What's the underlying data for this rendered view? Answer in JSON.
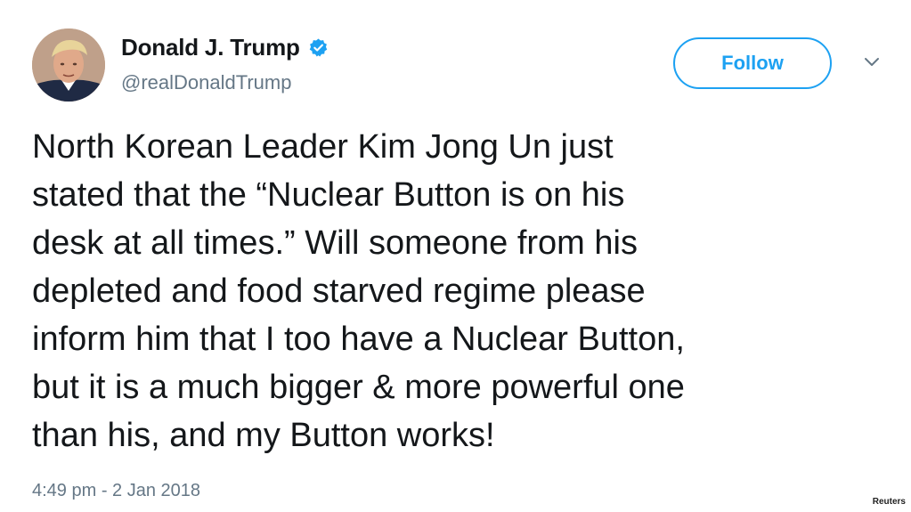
{
  "author": {
    "display_name": "Donald J. Trump",
    "handle": "@realDonaldTrump",
    "verified": true,
    "avatar_icon": "profile-photo"
  },
  "actions": {
    "follow_label": "Follow",
    "menu_icon": "chevron-down-icon"
  },
  "tweet": {
    "lines": [
      "North Korean Leader Kim Jong Un just",
      "stated that the “Nuclear Button is on his",
      "desk at all times.” Will someone from his",
      "depleted and food starved regime please",
      "inform him that I too have a Nuclear Button,",
      "but it is a much bigger & more powerful one",
      "than his, and my Button works!"
    ],
    "timestamp": "4:49 pm - 2 Jan 2018"
  },
  "credit": "Reuters",
  "colors": {
    "accent": "#1da1f2",
    "text": "#14171a",
    "muted": "#657786"
  }
}
